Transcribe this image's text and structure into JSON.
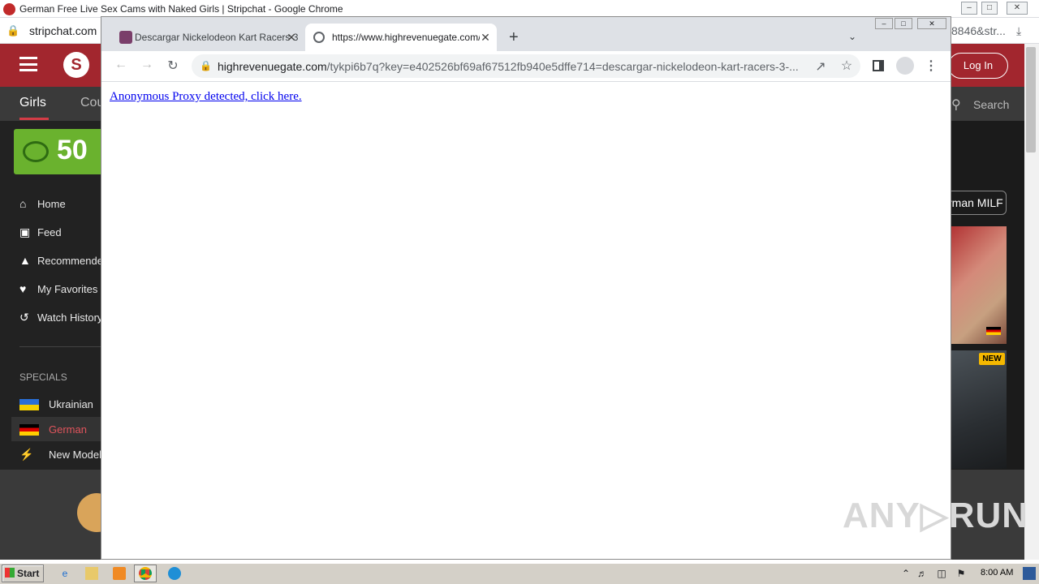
{
  "bg_window": {
    "title": "German Free Live Sex Cams with Naked Girls | Stripchat - Google Chrome",
    "url_left": "stripchat.com",
    "url_right": "8846&str...",
    "controls": [
      "–",
      "□",
      "✕"
    ]
  },
  "stripchat": {
    "logo_letter": "S",
    "login_label": "Log In",
    "tabs": [
      "Girls",
      "Cou"
    ],
    "search_label": "Search",
    "tokens": "50 ",
    "sidebar": [
      {
        "label": "Home",
        "icon": "home-icon"
      },
      {
        "label": "Feed",
        "icon": "feed-icon"
      },
      {
        "label": "Recommended",
        "icon": "thumbs-up-icon"
      },
      {
        "label": "My Favorites",
        "icon": "heart-icon"
      },
      {
        "label": "Watch History",
        "icon": "history-icon"
      }
    ],
    "specials_heading": "SPECIALS",
    "specials": [
      {
        "label": "Ukrainian",
        "icon": "ukraine-flag-icon"
      },
      {
        "label": "German",
        "icon": "germany-flag-icon"
      },
      {
        "label": "New Models",
        "icon": "lightning-icon"
      }
    ],
    "filter_chip": "rman MILF",
    "new_badge": "NEW"
  },
  "fg_window": {
    "tabs": [
      {
        "label": "Descargar Nickelodeon Kart Racers 3"
      },
      {
        "label": "https://www.highrevenuegate.com/"
      }
    ],
    "omnibox_domain": "highrevenuegate.com",
    "omnibox_path": "/tykpi6b7q?key=e402526bf69af67512fb940e5dffe714=descargar-nickelodeon-kart-racers-3-...",
    "page_link": "Anonymous Proxy detected, click here."
  },
  "taskbar": {
    "start_label": "Start",
    "clock": "8:00 AM"
  },
  "watermark": "ANY▷RUN",
  "colors": {
    "stripchat_red": "#a2262e",
    "tokens_green": "#6ab22e",
    "link_blue": "#0000ee"
  }
}
